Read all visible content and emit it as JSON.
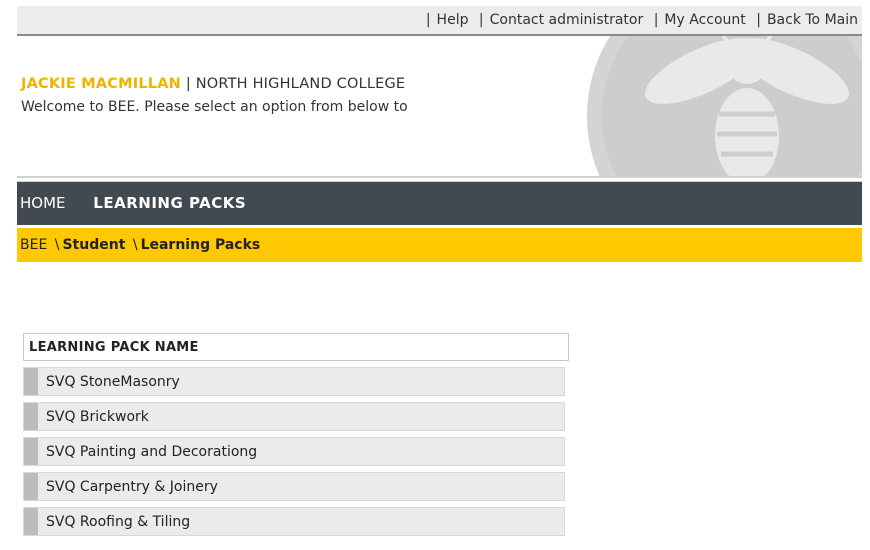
{
  "top_links": [
    "Help",
    "Contact administrator",
    "My Account",
    "Back To Main"
  ],
  "header": {
    "user_name": "JACKIE MACMILLAN",
    "separator": "|",
    "college": "NORTH HIGHLAND COLLEGE",
    "welcome": "Welcome to BEE. Please select an option from below to"
  },
  "nav": {
    "home": "HOME",
    "learning_packs": "LEARNING PACKS"
  },
  "breadcrumb": {
    "root": "BEE",
    "sep": "\\",
    "student": "Student",
    "current": "Learning Packs"
  },
  "table": {
    "header": "LEARNING PACK NAME",
    "rows": [
      "SVQ StoneMasonry",
      "SVQ Brickwork",
      "SVQ Painting and Decorationg",
      "SVQ Carpentry & Joinery",
      "SVQ Roofing & Tiling"
    ]
  },
  "colors": {
    "accent_yellow": "#ffc800",
    "nav_dark": "#414a50",
    "name_gold": "#f0b400"
  }
}
